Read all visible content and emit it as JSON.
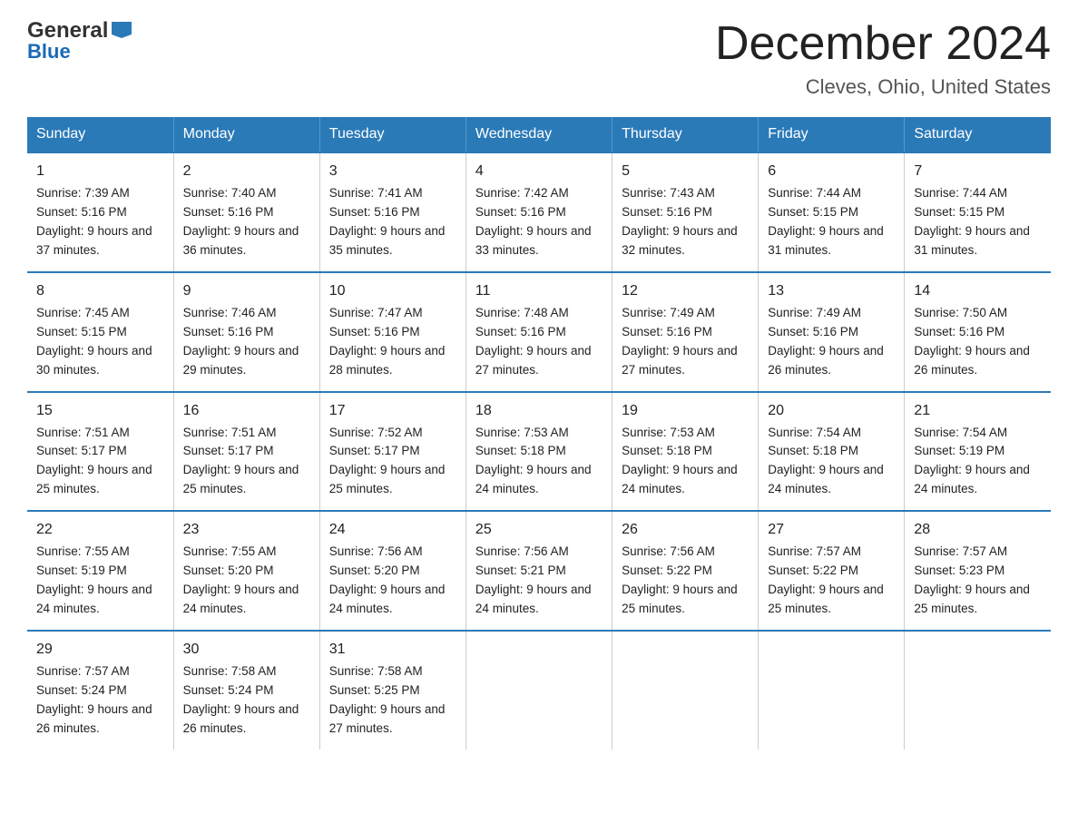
{
  "header": {
    "logo_line1": "General",
    "logo_line2": "Blue",
    "main_title": "December 2024",
    "subtitle": "Cleves, Ohio, United States"
  },
  "days_of_week": [
    "Sunday",
    "Monday",
    "Tuesday",
    "Wednesday",
    "Thursday",
    "Friday",
    "Saturday"
  ],
  "weeks": [
    [
      {
        "date": "1",
        "sunrise": "7:39 AM",
        "sunset": "5:16 PM",
        "daylight": "9 hours and 37 minutes."
      },
      {
        "date": "2",
        "sunrise": "7:40 AM",
        "sunset": "5:16 PM",
        "daylight": "9 hours and 36 minutes."
      },
      {
        "date": "3",
        "sunrise": "7:41 AM",
        "sunset": "5:16 PM",
        "daylight": "9 hours and 35 minutes."
      },
      {
        "date": "4",
        "sunrise": "7:42 AM",
        "sunset": "5:16 PM",
        "daylight": "9 hours and 33 minutes."
      },
      {
        "date": "5",
        "sunrise": "7:43 AM",
        "sunset": "5:16 PM",
        "daylight": "9 hours and 32 minutes."
      },
      {
        "date": "6",
        "sunrise": "7:44 AM",
        "sunset": "5:15 PM",
        "daylight": "9 hours and 31 minutes."
      },
      {
        "date": "7",
        "sunrise": "7:44 AM",
        "sunset": "5:15 PM",
        "daylight": "9 hours and 31 minutes."
      }
    ],
    [
      {
        "date": "8",
        "sunrise": "7:45 AM",
        "sunset": "5:15 PM",
        "daylight": "9 hours and 30 minutes."
      },
      {
        "date": "9",
        "sunrise": "7:46 AM",
        "sunset": "5:16 PM",
        "daylight": "9 hours and 29 minutes."
      },
      {
        "date": "10",
        "sunrise": "7:47 AM",
        "sunset": "5:16 PM",
        "daylight": "9 hours and 28 minutes."
      },
      {
        "date": "11",
        "sunrise": "7:48 AM",
        "sunset": "5:16 PM",
        "daylight": "9 hours and 27 minutes."
      },
      {
        "date": "12",
        "sunrise": "7:49 AM",
        "sunset": "5:16 PM",
        "daylight": "9 hours and 27 minutes."
      },
      {
        "date": "13",
        "sunrise": "7:49 AM",
        "sunset": "5:16 PM",
        "daylight": "9 hours and 26 minutes."
      },
      {
        "date": "14",
        "sunrise": "7:50 AM",
        "sunset": "5:16 PM",
        "daylight": "9 hours and 26 minutes."
      }
    ],
    [
      {
        "date": "15",
        "sunrise": "7:51 AM",
        "sunset": "5:17 PM",
        "daylight": "9 hours and 25 minutes."
      },
      {
        "date": "16",
        "sunrise": "7:51 AM",
        "sunset": "5:17 PM",
        "daylight": "9 hours and 25 minutes."
      },
      {
        "date": "17",
        "sunrise": "7:52 AM",
        "sunset": "5:17 PM",
        "daylight": "9 hours and 25 minutes."
      },
      {
        "date": "18",
        "sunrise": "7:53 AM",
        "sunset": "5:18 PM",
        "daylight": "9 hours and 24 minutes."
      },
      {
        "date": "19",
        "sunrise": "7:53 AM",
        "sunset": "5:18 PM",
        "daylight": "9 hours and 24 minutes."
      },
      {
        "date": "20",
        "sunrise": "7:54 AM",
        "sunset": "5:18 PM",
        "daylight": "9 hours and 24 minutes."
      },
      {
        "date": "21",
        "sunrise": "7:54 AM",
        "sunset": "5:19 PM",
        "daylight": "9 hours and 24 minutes."
      }
    ],
    [
      {
        "date": "22",
        "sunrise": "7:55 AM",
        "sunset": "5:19 PM",
        "daylight": "9 hours and 24 minutes."
      },
      {
        "date": "23",
        "sunrise": "7:55 AM",
        "sunset": "5:20 PM",
        "daylight": "9 hours and 24 minutes."
      },
      {
        "date": "24",
        "sunrise": "7:56 AM",
        "sunset": "5:20 PM",
        "daylight": "9 hours and 24 minutes."
      },
      {
        "date": "25",
        "sunrise": "7:56 AM",
        "sunset": "5:21 PM",
        "daylight": "9 hours and 24 minutes."
      },
      {
        "date": "26",
        "sunrise": "7:56 AM",
        "sunset": "5:22 PM",
        "daylight": "9 hours and 25 minutes."
      },
      {
        "date": "27",
        "sunrise": "7:57 AM",
        "sunset": "5:22 PM",
        "daylight": "9 hours and 25 minutes."
      },
      {
        "date": "28",
        "sunrise": "7:57 AM",
        "sunset": "5:23 PM",
        "daylight": "9 hours and 25 minutes."
      }
    ],
    [
      {
        "date": "29",
        "sunrise": "7:57 AM",
        "sunset": "5:24 PM",
        "daylight": "9 hours and 26 minutes."
      },
      {
        "date": "30",
        "sunrise": "7:58 AM",
        "sunset": "5:24 PM",
        "daylight": "9 hours and 26 minutes."
      },
      {
        "date": "31",
        "sunrise": "7:58 AM",
        "sunset": "5:25 PM",
        "daylight": "9 hours and 27 minutes."
      },
      {
        "date": "",
        "sunrise": "",
        "sunset": "",
        "daylight": ""
      },
      {
        "date": "",
        "sunrise": "",
        "sunset": "",
        "daylight": ""
      },
      {
        "date": "",
        "sunrise": "",
        "sunset": "",
        "daylight": ""
      },
      {
        "date": "",
        "sunrise": "",
        "sunset": "",
        "daylight": ""
      }
    ]
  ]
}
